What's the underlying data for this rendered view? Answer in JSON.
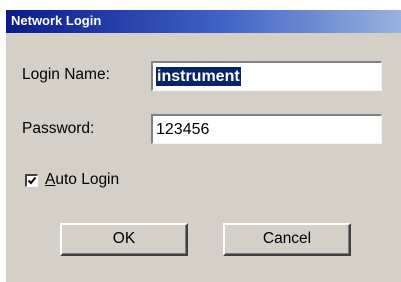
{
  "window": {
    "title": "Network Login"
  },
  "form": {
    "login_name_label": "Login Name:",
    "login_name_value": "instrument",
    "password_label": "Password:",
    "password_value": "123456",
    "auto_login_label": "Auto Login",
    "auto_login_checked": true
  },
  "buttons": {
    "ok_label": "OK",
    "cancel_label": "Cancel"
  },
  "colors": {
    "title_bar_start": "#0a1a8c",
    "title_bar_end": "#9ab2de",
    "dialog_face": "#d4d0c8",
    "selection": "#0a246a"
  }
}
